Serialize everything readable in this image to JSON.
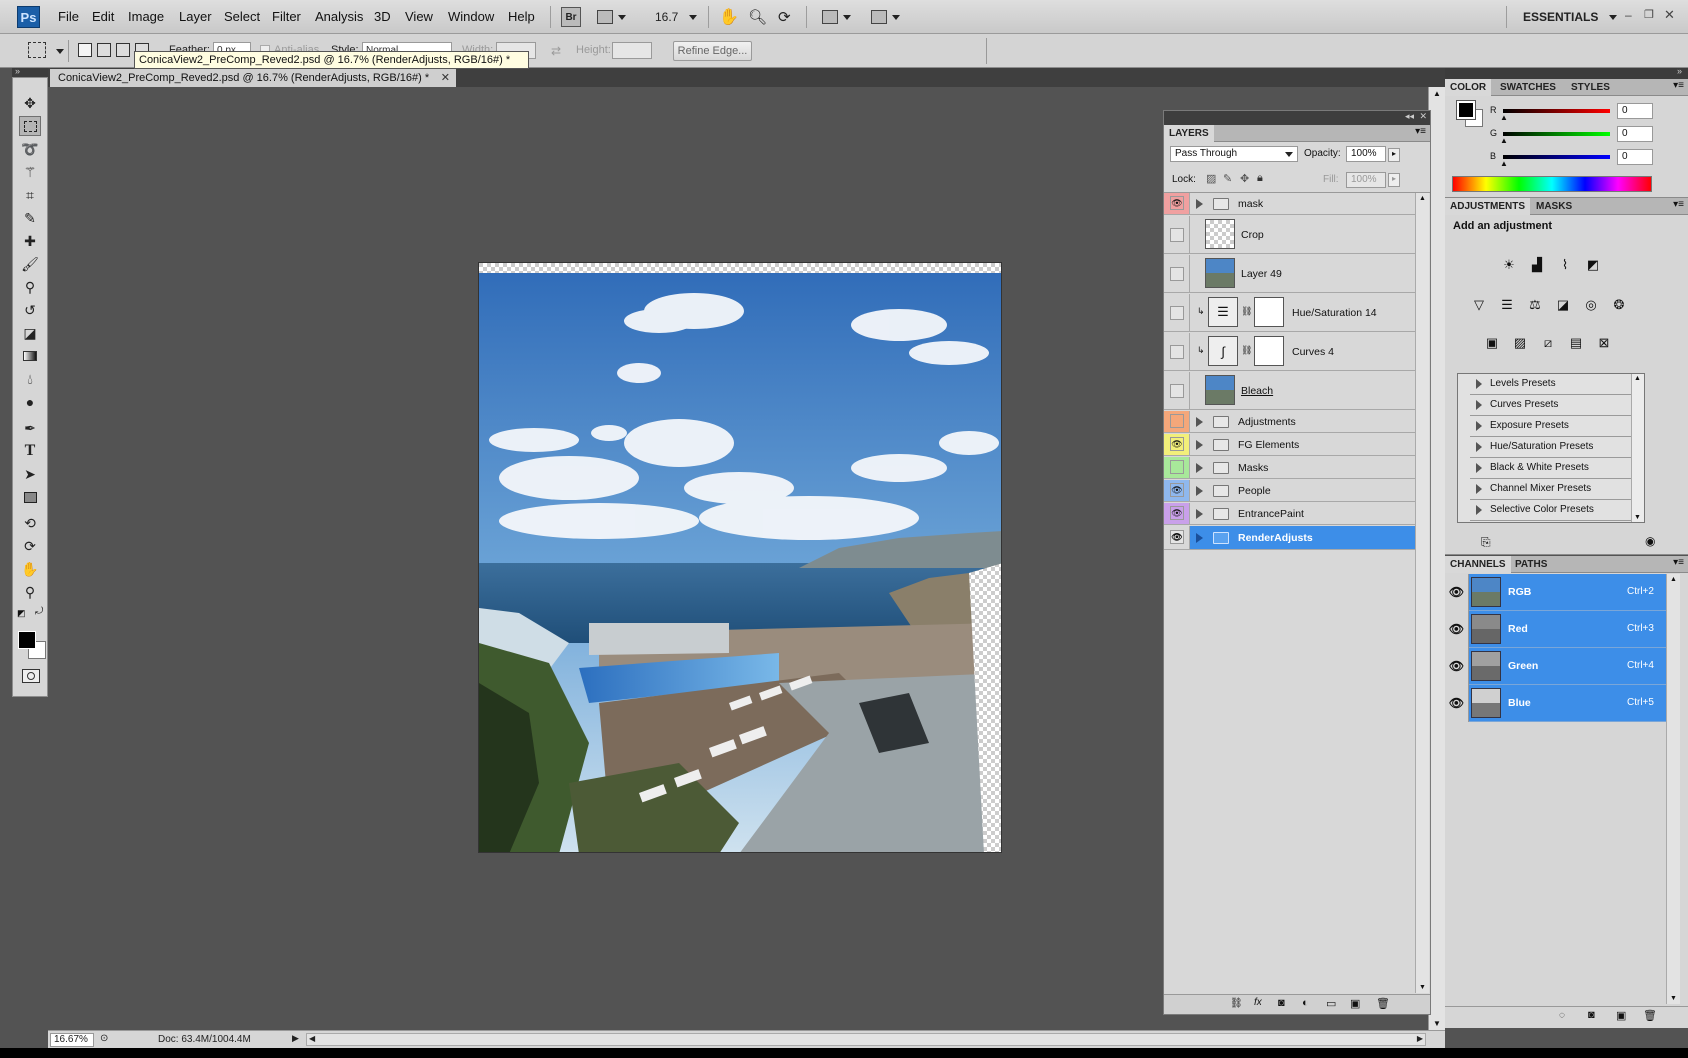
{
  "app": {
    "logo": "Ps",
    "menus": [
      "File",
      "Edit",
      "Image",
      "Layer",
      "Select",
      "Filter",
      "Analysis",
      "3D",
      "View",
      "Window",
      "Help"
    ],
    "bridge": "Br",
    "zoom_dropdown": "16.7",
    "workspace": "ESSENTIALS"
  },
  "options": {
    "feather_label": "Feather:",
    "feather_value": "0 px",
    "antialias": "Anti-alias",
    "style_label": "Style:",
    "style_value": "Normal",
    "width_label": "Width:",
    "height_label": "Height:",
    "refine_edge": "Refine Edge..."
  },
  "tooltip": "ConicaView2_PreComp_Reved2.psd @ 16.7% (RenderAdjusts, RGB/16#) *",
  "document": {
    "tab_title": "ConicaView2_PreComp_Reved2.psd @ 16.7% (RenderAdjusts, RGB/16#) *",
    "zoom": "16.67%",
    "doc_info": "Doc: 63.4M/1004.4M"
  },
  "tools": [
    "move-icon",
    "marquee-icon",
    "lasso-icon",
    "magic-wand-icon",
    "crop-icon",
    "eyedropper-icon",
    "healing-brush-icon",
    "brush-icon",
    "clone-stamp-icon",
    "history-brush-icon",
    "eraser-icon",
    "gradient-icon",
    "blur-icon",
    "dodge-icon",
    "pen-icon",
    "type-icon",
    "path-selection-icon",
    "shape-icon",
    "3d-rotate-icon",
    "3d-orbit-icon",
    "hand-icon",
    "zoom-icon"
  ],
  "layers_panel": {
    "tab": "LAYERS",
    "blend_mode": "Pass Through",
    "opacity_label": "Opacity:",
    "opacity": "100%",
    "lock_label": "Lock:",
    "fill_label": "Fill:",
    "fill": "100%",
    "layers": [
      {
        "name": "mask",
        "type": "group",
        "visible": true,
        "color": "#f0a0a0"
      },
      {
        "name": "Crop",
        "type": "layer",
        "visible": false
      },
      {
        "name": "Layer 49",
        "type": "layer",
        "visible": false
      },
      {
        "name": "Hue/Saturation 14",
        "type": "adjustment",
        "visible": false
      },
      {
        "name": "Curves 4",
        "type": "adjustment",
        "visible": false
      },
      {
        "name": "Bleach",
        "type": "layer",
        "visible": false
      },
      {
        "name": "Adjustments",
        "type": "group",
        "visible": false,
        "color": "#f4a77a"
      },
      {
        "name": "FG Elements",
        "type": "group",
        "visible": true,
        "color": "#f2ef7a"
      },
      {
        "name": "Masks",
        "type": "group",
        "visible": false,
        "color": "#a8e89a"
      },
      {
        "name": "People",
        "type": "group",
        "visible": true,
        "color": "#8fb8ee"
      },
      {
        "name": "EntrancePaint",
        "type": "group",
        "visible": true,
        "color": "#c9a0ea"
      },
      {
        "name": "RenderAdjusts",
        "type": "group",
        "visible": true,
        "selected": true
      }
    ]
  },
  "color_panel": {
    "tabs": [
      "COLOR",
      "SWATCHES",
      "STYLES"
    ],
    "r_label": "R",
    "g_label": "G",
    "b_label": "B",
    "r": "0",
    "g": "0",
    "b": "0"
  },
  "adjustments_panel": {
    "tabs": [
      "ADJUSTMENTS",
      "MASKS"
    ],
    "heading": "Add an adjustment",
    "presets": [
      "Levels Presets",
      "Curves Presets",
      "Exposure Presets",
      "Hue/Saturation Presets",
      "Black & White Presets",
      "Channel Mixer Presets",
      "Selective Color Presets"
    ]
  },
  "channels_panel": {
    "tabs": [
      "CHANNELS",
      "PATHS"
    ],
    "channels": [
      {
        "name": "RGB",
        "shortcut": "Ctrl+2"
      },
      {
        "name": "Red",
        "shortcut": "Ctrl+3"
      },
      {
        "name": "Green",
        "shortcut": "Ctrl+4"
      },
      {
        "name": "Blue",
        "shortcut": "Ctrl+5"
      }
    ]
  },
  "colors": {
    "selection": "#3d8ee8",
    "canvas_bg": "#535353"
  }
}
